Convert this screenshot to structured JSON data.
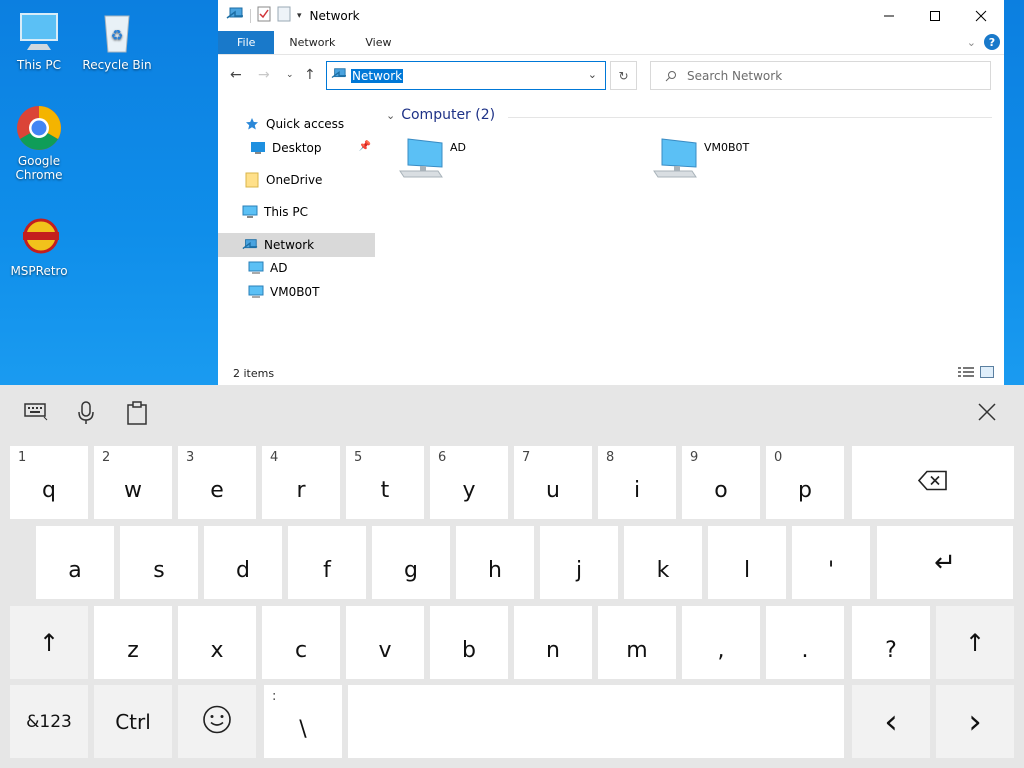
{
  "desktop": {
    "icons": [
      {
        "label": "This PC",
        "icon": "monitor-icon"
      },
      {
        "label": "Recycle Bin",
        "icon": "recycle-bin-icon"
      },
      {
        "label": "Google Chrome",
        "icon": "chrome-icon"
      },
      {
        "label": "MSPRetro",
        "icon": "mspretro-icon"
      }
    ]
  },
  "window": {
    "title": "Network",
    "ribbon": {
      "file": "File",
      "network": "Network",
      "view": "View",
      "help": "?"
    },
    "address": {
      "value": "Network"
    },
    "search": {
      "placeholder": "Search Network"
    },
    "nav": {
      "items": [
        {
          "label": "Quick access",
          "icon": "star-icon"
        },
        {
          "label": "Desktop",
          "icon": "desktop-folder-icon"
        },
        {
          "label": "OneDrive",
          "icon": "folder-icon"
        },
        {
          "label": "This PC",
          "icon": "monitor-icon"
        },
        {
          "label": "Network",
          "icon": "network-icon"
        },
        {
          "label": "AD",
          "icon": "computer-icon"
        },
        {
          "label": "VM0B0T",
          "icon": "computer-icon"
        }
      ]
    },
    "content": {
      "group": "Computer (2)",
      "computers": [
        "AD",
        "VM0B0T"
      ]
    },
    "status": "2 items"
  },
  "keyboard": {
    "row1": [
      {
        "alt": "1",
        "key": "q"
      },
      {
        "alt": "2",
        "key": "w"
      },
      {
        "alt": "3",
        "key": "e"
      },
      {
        "alt": "4",
        "key": "r"
      },
      {
        "alt": "5",
        "key": "t"
      },
      {
        "alt": "6",
        "key": "y"
      },
      {
        "alt": "7",
        "key": "u"
      },
      {
        "alt": "8",
        "key": "i"
      },
      {
        "alt": "9",
        "key": "o"
      },
      {
        "alt": "0",
        "key": "p"
      }
    ],
    "row2": [
      "a",
      "s",
      "d",
      "f",
      "g",
      "h",
      "j",
      "k",
      "l",
      "'"
    ],
    "row3": [
      "z",
      "x",
      "c",
      "v",
      "b",
      "n",
      "m",
      ",",
      ".",
      "?"
    ],
    "row4": {
      "sym": "&123",
      "ctrl": "Ctrl",
      "backslash_alt": ":",
      "backslash": "\\"
    },
    "glyphs": {
      "shift": "↑",
      "enter": "↵",
      "left": "‹",
      "right": "›",
      "close": "✕"
    },
    "accent": "#0078d7"
  }
}
